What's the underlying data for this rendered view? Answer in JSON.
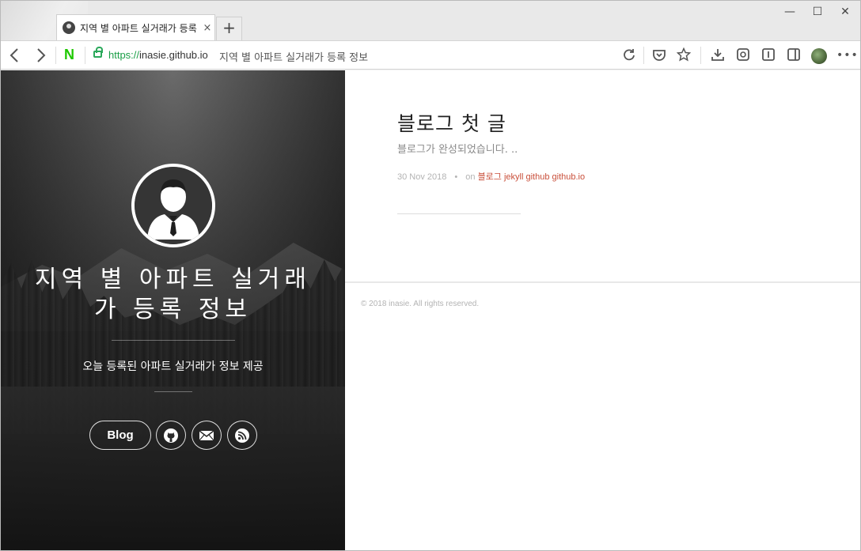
{
  "browser": {
    "tab": {
      "title": "지역 별 아파트 실거래가 등록 정보",
      "close_glyph": "×"
    },
    "new_tab_glyph": "+",
    "window_controls": {
      "minimize": "—",
      "maximize": "☐",
      "close": "✕"
    },
    "address": {
      "scheme": "https://",
      "host": "inasie.github.io",
      "page_title": "지역 별 아파트 실거래가 등록 정보"
    },
    "nav": {
      "back": "‹",
      "forward": "›",
      "naver": "N"
    },
    "toolbar_icons": [
      "reload-icon",
      "pocket-icon",
      "star-icon",
      "download-icon",
      "capture-icon",
      "reader-icon",
      "sidebar-icon",
      "profile-avatar",
      "more-icon"
    ]
  },
  "hero": {
    "title": "지역 별 아파트 실거래가 등록 정보",
    "subtitle": "오늘 등록된 아파트 실거래가 정보 제공",
    "blog_label": "Blog",
    "social_icons": [
      "github-icon",
      "mail-icon",
      "rss-icon"
    ]
  },
  "post": {
    "title": "블로그 첫 글",
    "excerpt": "블로그가 완성되었습니다. ..",
    "date": "30 Nov 2018",
    "dot": "•",
    "on": "on",
    "tags": "블로그 jekyll github github.io"
  },
  "footer": {
    "copyright": "© 2018 inasie. All rights reserved."
  },
  "colors": {
    "link_red": "#c94f3a",
    "url_green": "#1a9e46",
    "naver_green": "#1ec800"
  }
}
